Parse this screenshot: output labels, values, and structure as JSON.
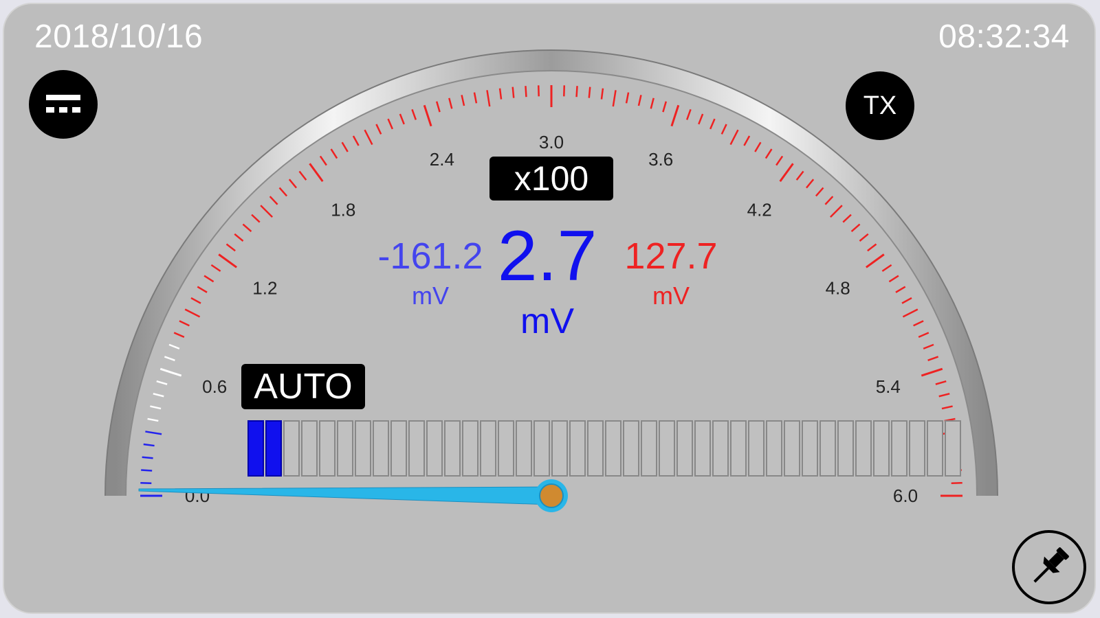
{
  "header": {
    "date": "2018/10/16",
    "time": "08:32:34"
  },
  "buttons": {
    "tx_label": "TX"
  },
  "gauge": {
    "scale_labels": [
      "0.0",
      "0.6",
      "1.2",
      "1.8",
      "2.4",
      "3.0",
      "3.6",
      "4.2",
      "4.8",
      "5.4",
      "6.0"
    ],
    "scale_min": 0,
    "scale_max": 6,
    "needle_value": 0.027,
    "multiplier": "x100",
    "range_mode": "AUTO"
  },
  "readings": {
    "main_value": "2.7",
    "main_unit": "mV",
    "min_value": "-161.2",
    "min_unit": "mV",
    "max_value": "127.7",
    "max_unit": "mV"
  },
  "bargraph": {
    "total_segments": 40,
    "active_segments": 2
  },
  "colors": {
    "panel_bg": "#bdbdbd",
    "main_reading": "#1010ee",
    "min_reading": "#4444ee",
    "max_reading": "#ee2222",
    "tick_red": "#ee2222",
    "tick_white": "#ffffff",
    "tick_blue": "#2222ee",
    "needle": "#29b6e8",
    "hub": "#d08a30"
  },
  "icons": {
    "menu": "menu-icon",
    "pin": "pushpin-icon"
  }
}
